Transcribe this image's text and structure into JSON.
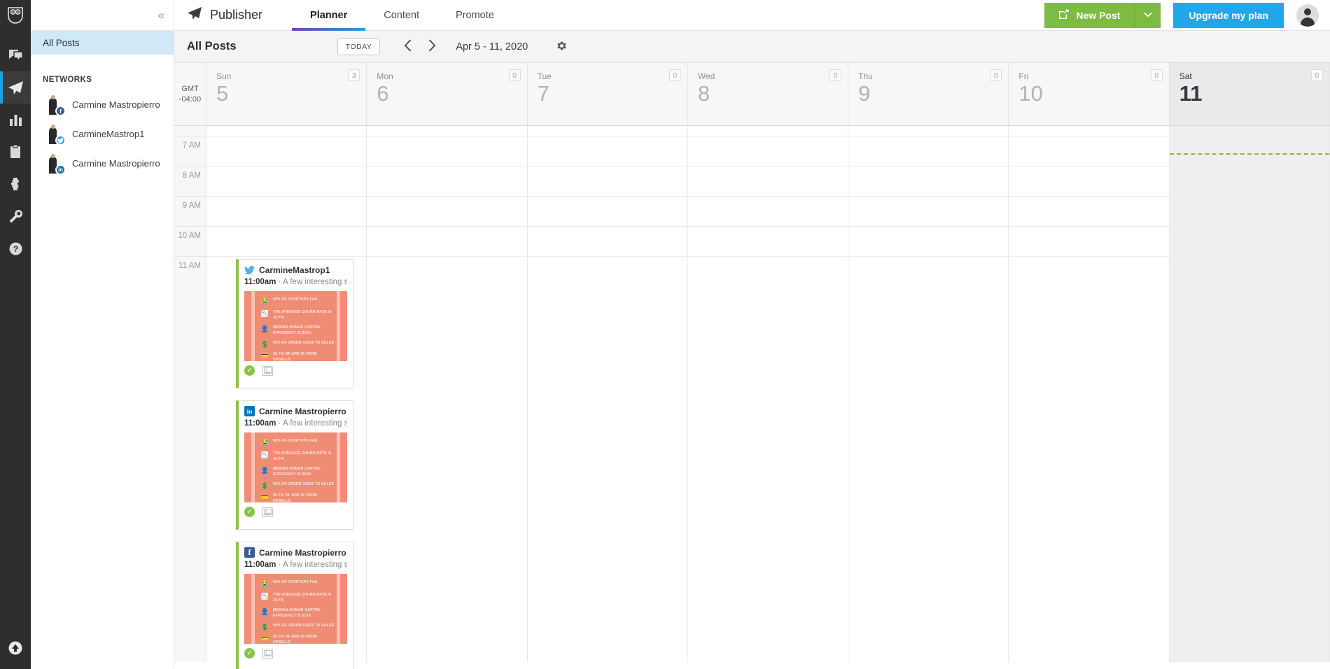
{
  "rail": {
    "logo_icon": "hootsuite-owl-logo",
    "items": [
      {
        "name": "streams",
        "icon": "speech-bubbles-icon",
        "active": false
      },
      {
        "name": "publisher",
        "icon": "paper-plane-icon",
        "active": true
      },
      {
        "name": "analytics",
        "icon": "bar-chart-icon",
        "active": false
      },
      {
        "name": "assignments",
        "icon": "clipboard-icon",
        "active": false
      },
      {
        "name": "apps",
        "icon": "puzzle-piece-icon",
        "active": false
      },
      {
        "name": "tools",
        "icon": "wrench-icon",
        "active": false
      },
      {
        "name": "help",
        "icon": "question-circle-icon",
        "active": false
      }
    ],
    "bottom_icon": "upgrade-arrow-icon"
  },
  "topbar": {
    "brand_icon": "paper-plane-icon",
    "brand_title": "Publisher",
    "tabs": [
      {
        "label": "Planner",
        "active": true
      },
      {
        "label": "Content",
        "active": false
      },
      {
        "label": "Promote",
        "active": false
      }
    ],
    "new_post_label": "New Post",
    "new_post_icon": "compose-pencil-icon",
    "new_post_caret_icon": "chevron-down-icon",
    "upgrade_label": "Upgrade my plan",
    "avatar_name": "user-avatar",
    "colors": {
      "green": "#7dbb42",
      "blue": "#22a7ea",
      "tab_accent_from": "#7b3fbf",
      "tab_accent_to": "#1ca3dd"
    }
  },
  "sidebar": {
    "collapse_icon": "chevron-double-left-icon",
    "all_posts_label": "All Posts",
    "networks_header": "NETWORKS",
    "networks": [
      {
        "name": "Carmine Mastropierro",
        "network": "facebook",
        "badge": "f"
      },
      {
        "name": "CarmineMastrop1",
        "network": "twitter",
        "badge": ""
      },
      {
        "name": "Carmine Mastropierro",
        "network": "linkedin",
        "badge": "in"
      }
    ]
  },
  "calendar": {
    "title": "All Posts",
    "today_label": "TODAY",
    "prev_icon": "chevron-left-icon",
    "next_icon": "chevron-right-icon",
    "date_range": "Apr 5 - 11, 2020",
    "settings_icon": "gear-icon",
    "timezone_line1": "GMT",
    "timezone_line2": "-04:00",
    "days": [
      {
        "dow": "Sun",
        "num": "5",
        "count": "3",
        "today": false
      },
      {
        "dow": "Mon",
        "num": "6",
        "count": "0",
        "today": false
      },
      {
        "dow": "Tue",
        "num": "7",
        "count": "0",
        "today": false
      },
      {
        "dow": "Wed",
        "num": "8",
        "count": "0",
        "today": false
      },
      {
        "dow": "Thu",
        "num": "9",
        "count": "0",
        "today": false
      },
      {
        "dow": "Fri",
        "num": "10",
        "count": "0",
        "today": false
      },
      {
        "dow": "Sat",
        "num": "11",
        "count": "0",
        "today": true
      }
    ],
    "time_slots": [
      "7 AM",
      "8 AM",
      "9 AM",
      "10 AM",
      "11 AM"
    ],
    "now_line_color": "#8ab84a"
  },
  "posts": [
    {
      "network": "twitter",
      "author": "CarmineMastrop1",
      "time": "11:00am",
      "separator": " · ",
      "text": "A few interesting startu",
      "status_icon": "approved-check-icon",
      "attachment_icon": "image-attachment-icon",
      "thumb_color": "#ef8d74",
      "thumb_lines": [
        {
          "icon": "😭",
          "text": "90% OF STARTUPS FAIL"
        },
        {
          "icon": "📉",
          "text": "THE AVERAGE CHURN RATE IS 10.7%"
        },
        {
          "icon": "👤",
          "text": "MEDIAN HUMAN CAPITAL EFFICIENCY IS $10K"
        },
        {
          "icon": "💲",
          "text": "50% OF SPEND GOES TO SALES"
        },
        {
          "icon": "💳",
          "text": "26.7% OF ARR IS FROM UPSELLS"
        }
      ]
    },
    {
      "network": "linkedin",
      "author": "Carmine Mastropierro",
      "time": "11:00am",
      "separator": " · ",
      "text": "A few interesting startu",
      "status_icon": "approved-check-icon",
      "attachment_icon": "image-attachment-icon",
      "thumb_color": "#ef8d74",
      "thumb_lines": [
        {
          "icon": "😭",
          "text": "90% OF STARTUPS FAIL"
        },
        {
          "icon": "📉",
          "text": "THE AVERAGE CHURN RATE IS 10.7%"
        },
        {
          "icon": "👤",
          "text": "MEDIAN HUMAN CAPITAL EFFICIENCY IS $10K"
        },
        {
          "icon": "💲",
          "text": "50% OF SPEND GOES TO SALES"
        },
        {
          "icon": "💳",
          "text": "26.7% OF ARR IS FROM UPSELLS"
        }
      ]
    },
    {
      "network": "facebook",
      "author": "Carmine Mastropierro",
      "time": "11:00am",
      "separator": " · ",
      "text": "A few interesting startu",
      "status_icon": "approved-check-icon",
      "attachment_icon": "image-attachment-icon",
      "thumb_color": "#ef8d74",
      "thumb_lines": [
        {
          "icon": "😭",
          "text": "90% OF STARTUPS FAIL"
        },
        {
          "icon": "📉",
          "text": "THE AVERAGE CHURN RATE IS 10.7%"
        },
        {
          "icon": "👤",
          "text": "MEDIAN HUMAN CAPITAL EFFICIENCY IS $10K"
        },
        {
          "icon": "💲",
          "text": "50% OF SPEND GOES TO SALES"
        },
        {
          "icon": "💳",
          "text": "26.7% OF ARR IS FROM UPSELLS"
        }
      ]
    }
  ]
}
